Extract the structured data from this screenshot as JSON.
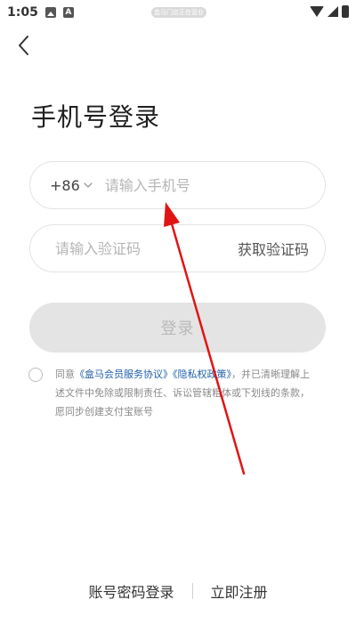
{
  "status_bar": {
    "time": "1:05",
    "a_label": "A",
    "center_pill": "盒马门店正在营业"
  },
  "page": {
    "title": "手机号登录"
  },
  "phone_field": {
    "country_code": "+86",
    "placeholder": "请输入手机号"
  },
  "code_field": {
    "placeholder": "请输入验证码",
    "get_code_label": "获取验证码"
  },
  "login_button": {
    "label": "登录"
  },
  "agreement": {
    "prefix": "同意",
    "service_agreement": "《盒马会员服务协议》",
    "privacy_policy": "《隐私权政策》",
    "suffix": "，并已清晰理解上述文件中免除或限制责任、诉讼管辖粗体或下划线的条款，愿同步创建支付宝账号"
  },
  "bottom": {
    "password_login": "账号密码登录",
    "register": "立即注册"
  },
  "colors": {
    "accent_link": "#1f5fa8",
    "annotation_arrow": "#e11414",
    "disabled_button_bg": "#e4e4e4"
  }
}
